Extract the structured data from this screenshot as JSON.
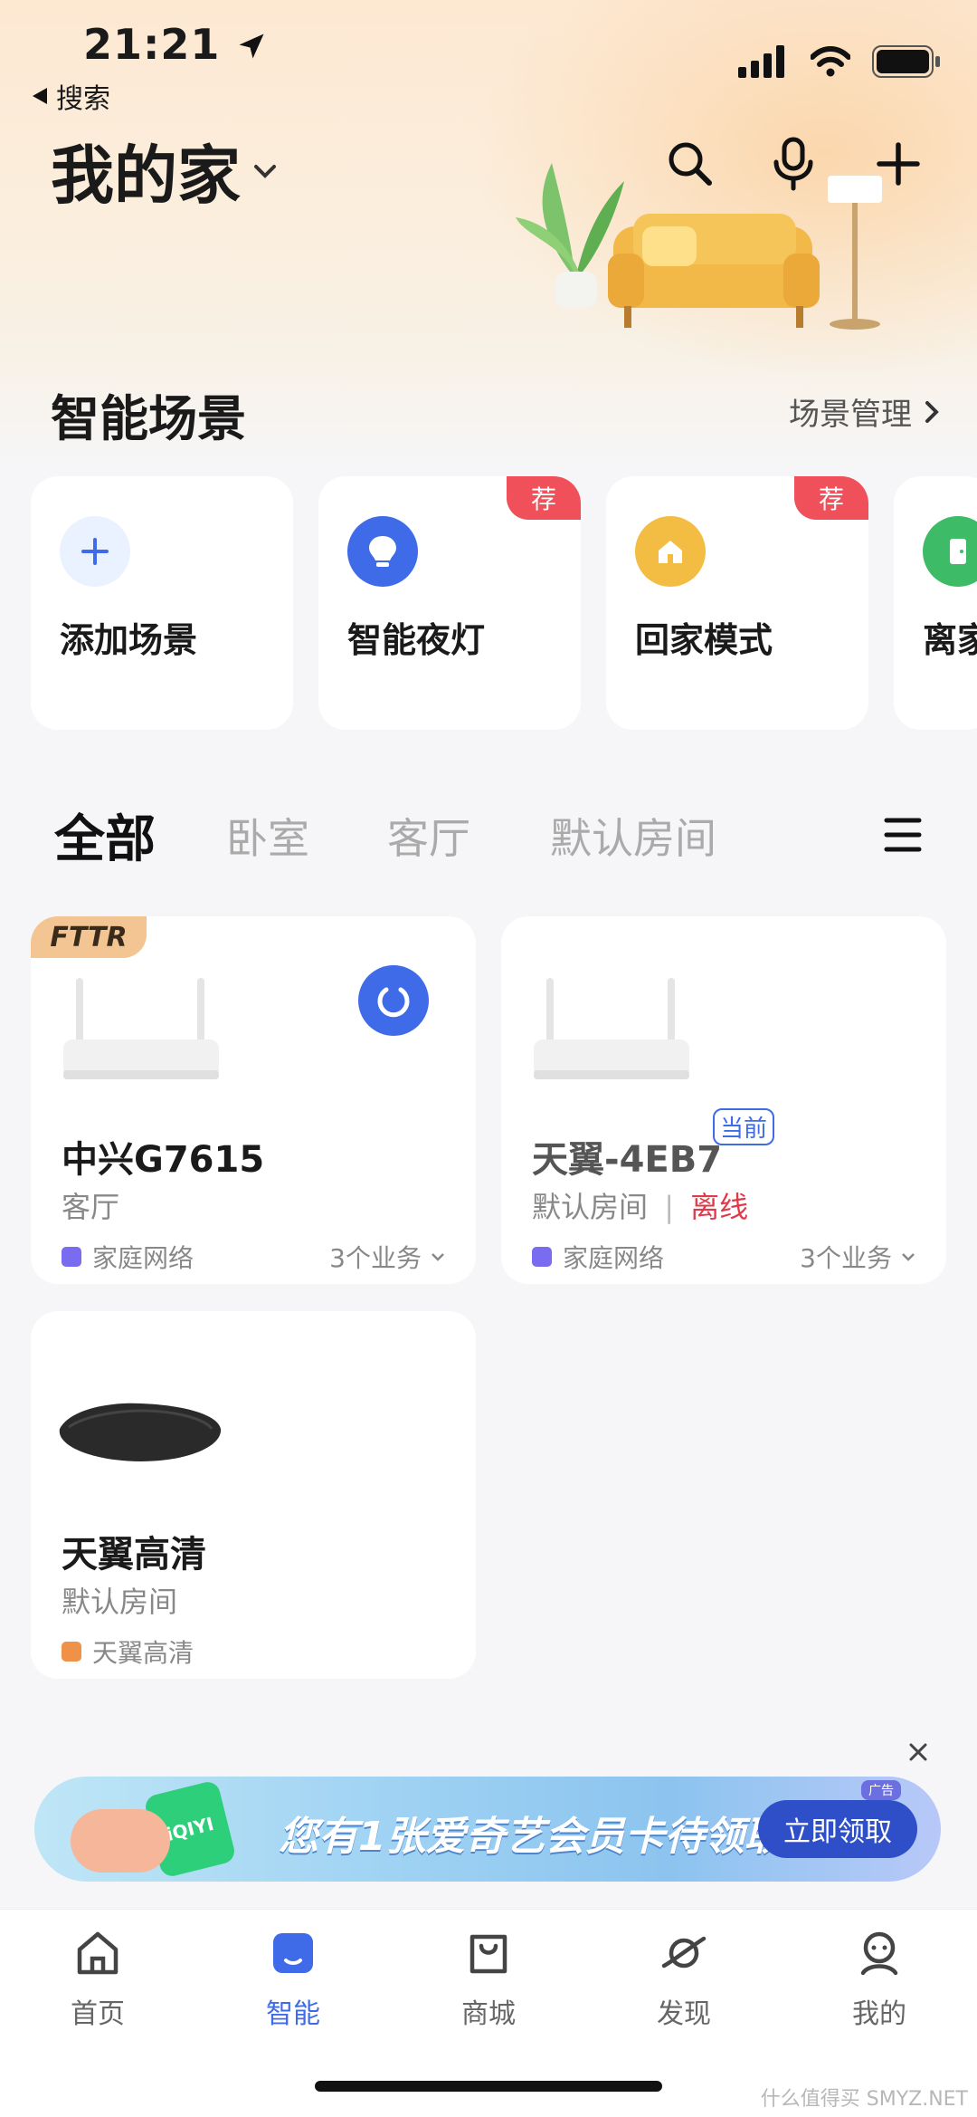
{
  "status_bar": {
    "time": "21:21",
    "back_label": "搜索"
  },
  "header": {
    "home_title": "我的家"
  },
  "scenes": {
    "title": "智能场景",
    "manage_label": "场景管理",
    "recommend_badge": "荐",
    "items": [
      {
        "label": "添加场景",
        "icon": "plus-icon",
        "color": "#e9f0ff"
      },
      {
        "label": "智能夜灯",
        "icon": "bulb-icon",
        "color": "#3f6be8",
        "recommended": true
      },
      {
        "label": "回家模式",
        "icon": "house-icon",
        "color": "#f3bd44",
        "recommended": true
      },
      {
        "label": "离家",
        "icon": "door-icon",
        "color": "#3dbb67"
      }
    ]
  },
  "rooms": {
    "tabs": [
      "全部",
      "卧室",
      "客厅",
      "默认房间"
    ]
  },
  "devices": [
    {
      "tag": "FTTR",
      "name": "中兴G7615",
      "room": "客厅",
      "network": "家庭网络",
      "services": "3个业务"
    },
    {
      "name": "天翼-4EB7",
      "badge": "当前",
      "room": "默认房间",
      "status": "离线",
      "network": "家庭网络",
      "services": "3个业务"
    },
    {
      "name": "天翼高清",
      "room": "默认房间",
      "network": "天翼高清"
    }
  ],
  "ad": {
    "text": "您有1张爱奇艺会员卡待领取",
    "button": "立即领取",
    "tag": "广告",
    "logo": "iQIYI"
  },
  "nav": [
    {
      "label": "首页",
      "icon": "home-icon"
    },
    {
      "label": "智能",
      "icon": "smart-icon",
      "active": true
    },
    {
      "label": "商城",
      "icon": "bag-icon"
    },
    {
      "label": "发现",
      "icon": "planet-icon"
    },
    {
      "label": "我的",
      "icon": "profile-icon"
    }
  ],
  "watermark": "什么值得买 SMYZ.NET"
}
